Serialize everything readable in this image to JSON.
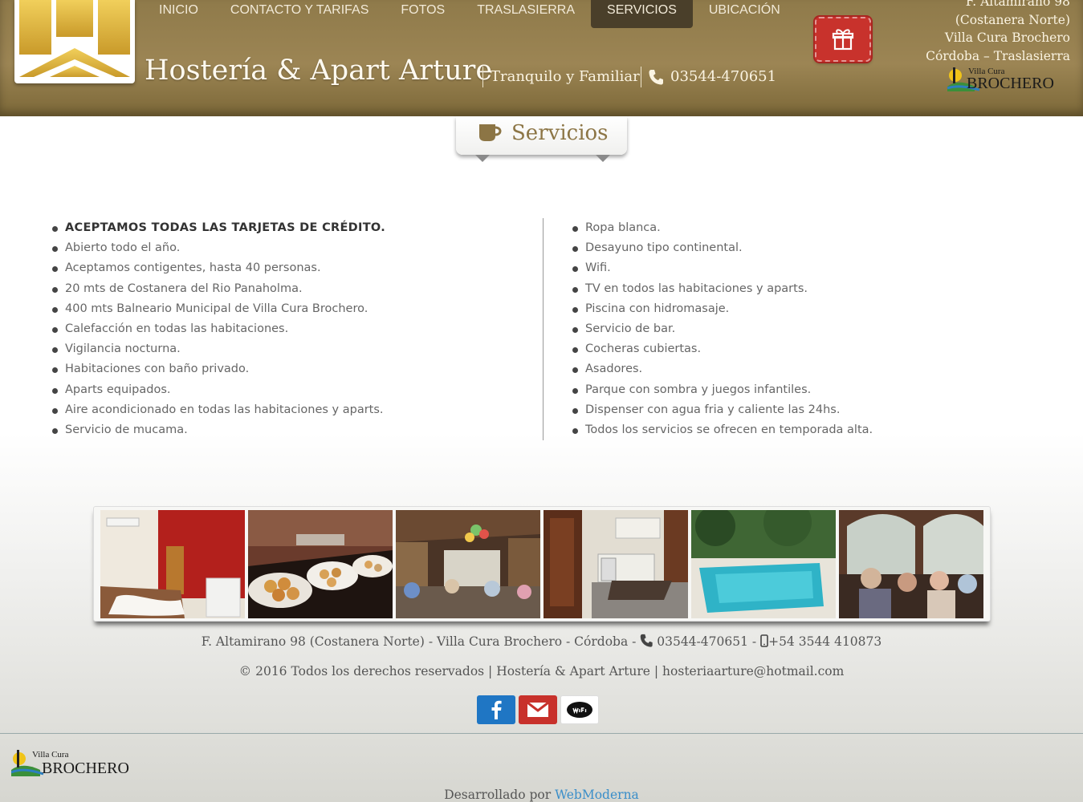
{
  "nav": {
    "items": [
      "INICIO",
      "CONTACTO Y TARIFAS",
      "FOTOS",
      "TRASLASIERRA",
      "SERVICIOS",
      "UBICACIÓN"
    ],
    "active": "SERVICIOS"
  },
  "header": {
    "title": "Hostería & Apart Arture",
    "tagline": "Tranquilo y Familiar",
    "phone": "03544-470651",
    "address": {
      "line1": "F. Altamirano 98",
      "line2": "(Costanera Norte)",
      "line3": "Villa Cura Brochero",
      "line4": "Córdoba – Traslasierra"
    },
    "brochero_logo": {
      "top": "Villa Cura",
      "bottom": "BROCHERO"
    }
  },
  "section": {
    "title": "Servicios",
    "icon": "coffee-icon"
  },
  "services": {
    "left": [
      "ACEPTAMOS TODAS LAS TARJETAS DE CRÉDITO.",
      "Abierto todo el año.",
      "Aceptamos contigentes, hasta 40 personas.",
      "20 mts de Costanera del Rio Panaholma.",
      "400 mts Balneario Municipal de Villa Cura Brochero.",
      "Calefacción en todas las habitaciones.",
      "Vigilancia nocturna.",
      "Habitaciones con baño privado.",
      "Aparts equipados.",
      "Aire acondicionado en todas las habitaciones y aparts.",
      "Servicio de mucama."
    ],
    "right": [
      "Ropa blanca.",
      "Desayuno tipo continental.",
      "Wifi.",
      "TV en todos las habitaciones y aparts.",
      "Piscina con hidromasaje.",
      "Servicio de bar.",
      "Cocheras cubiertas.",
      "Asadores.",
      "Parque con sombra y juegos infantiles.",
      "Dispenser con agua fria y caliente las 24hs.",
      "Todos los servicios se ofrecen en temporada alta."
    ]
  },
  "footer": {
    "address_line": "F. Altamirano 98 (Costanera Norte) - Villa Cura Brochero - Córdoba -",
    "phone": "03544-470651",
    "separator": "-",
    "mobile": "+54 3544 410873",
    "copyright": "© 2016 Todos los derechos reservados | Hostería & Apart Arture | hosteriaarture@hotmail.com",
    "credit_prefix": "Desarrollado por",
    "credit_link": "WebModerna"
  },
  "colors": {
    "header_bg": "#9c8554",
    "nav_active_bg": "#4a3f2a",
    "accent_text": "#8c7545",
    "gift_button": "#c8322c",
    "facebook": "#1f76c4",
    "mail": "#c8312b",
    "link": "#3a8ec9"
  }
}
